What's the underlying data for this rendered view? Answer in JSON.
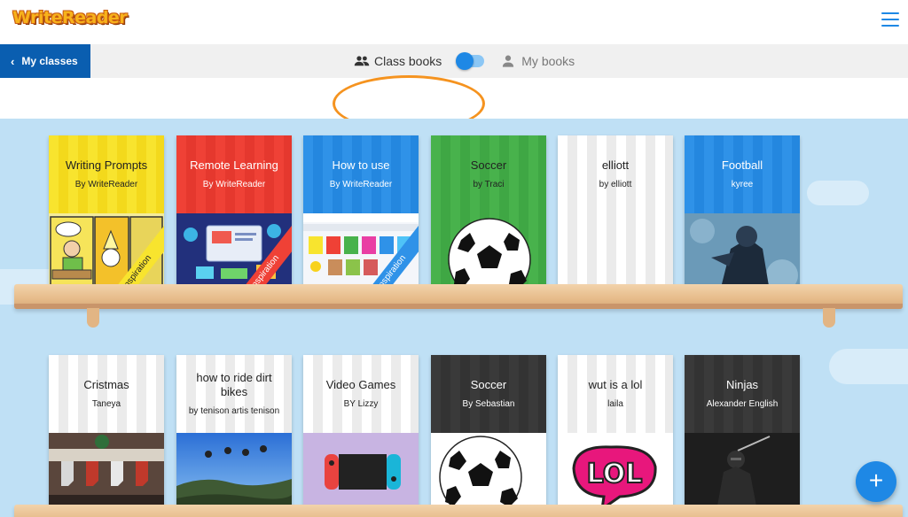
{
  "app": {
    "logo_text": "WriteReader"
  },
  "nav": {
    "back_label": "My classes",
    "toggle_left_label": "Class books",
    "toggle_right_label": "My books",
    "toggle_state": "class-books"
  },
  "fab_label": "+",
  "shelves": [
    {
      "books": [
        {
          "title": "Writing Prompts",
          "author": "By WriteReader",
          "ribbon": "Inspiration",
          "cover_color": "#f8e42e",
          "image": "comic-prompts"
        },
        {
          "title": "Remote Learning",
          "author": "By WriteReader",
          "ribbon": "Inspiration",
          "cover_color": "#ef4136",
          "image": "online-learning"
        },
        {
          "title": "How to use",
          "author": "By WriteReader",
          "ribbon": "Inspiration",
          "cover_color": "#2f92e8",
          "image": "app-screenshot"
        },
        {
          "title": "Soccer",
          "author": "by Traci",
          "cover_color": "#48b24c",
          "image": "soccer-ball"
        },
        {
          "title": "elliott",
          "author": "by elliott",
          "cover_color": "#ffffff",
          "image": "blank"
        },
        {
          "title": "Football",
          "author": "kyree",
          "cover_color": "#2f92e8",
          "image": "football-player"
        }
      ]
    },
    {
      "books": [
        {
          "title": "Cristmas",
          "author": "Taneya",
          "cover_color": "#ffffff",
          "image": "christmas-fireplace"
        },
        {
          "title": "how to ride dirt bikes",
          "author": "by tenison artis tenison",
          "cover_color": "#ffffff",
          "image": "dirt-bikes"
        },
        {
          "title": "Video Games",
          "author": "BY Lizzy",
          "cover_color": "#ffffff",
          "image": "nintendo-switch"
        },
        {
          "title": "Soccer",
          "author": "By Sebastian",
          "cover_color": "#3a3a3a",
          "image": "soccer-ball"
        },
        {
          "title": "wut is a lol",
          "author": "laila",
          "cover_color": "#ffffff",
          "image": "lol-text"
        },
        {
          "title": "Ninjas",
          "author": "Alexander English",
          "cover_color": "#3a3a3a",
          "image": "ninja"
        }
      ]
    }
  ]
}
